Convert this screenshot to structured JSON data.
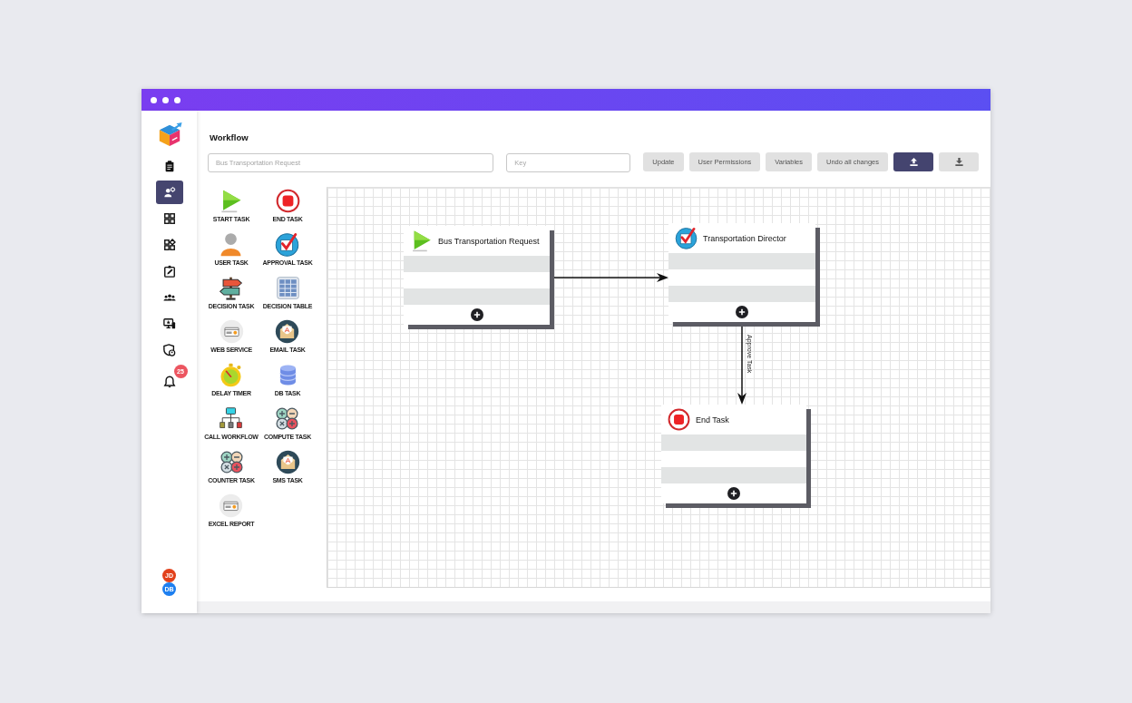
{
  "sidebar": {
    "items": [
      {
        "kind": "clipboard",
        "selected": false
      },
      {
        "kind": "assign",
        "selected": true
      },
      {
        "kind": "apps",
        "selected": false
      },
      {
        "kind": "widgets",
        "selected": false
      },
      {
        "kind": "edit",
        "selected": false
      },
      {
        "kind": "team",
        "selected": false
      },
      {
        "kind": "monitor",
        "selected": false
      },
      {
        "kind": "security",
        "selected": false
      },
      {
        "kind": "bell",
        "selected": false,
        "badge": "25"
      }
    ],
    "users": [
      {
        "initials": "JD",
        "color": "#e2411b"
      },
      {
        "initials": "DB",
        "color": "#1d7ff0"
      }
    ]
  },
  "header": {
    "title": "Workflow",
    "name_field": {
      "value": "Bus Transportation Request"
    },
    "key_field": {
      "placeholder": "Key"
    },
    "buttons": [
      {
        "kind": "text",
        "label": "Update",
        "primary": false
      },
      {
        "kind": "text",
        "label": "User Permissions",
        "primary": false
      },
      {
        "kind": "text",
        "label": "Variables",
        "primary": false
      },
      {
        "kind": "text",
        "label": "Undo all changes",
        "primary": false
      },
      {
        "kind": "upload",
        "primary": true
      },
      {
        "kind": "download",
        "primary": false
      }
    ]
  },
  "palette": {
    "items": [
      {
        "kind": "start",
        "label": "START TASK"
      },
      {
        "kind": "end",
        "label": "END TASK"
      },
      {
        "kind": "user",
        "label": "USER TASK"
      },
      {
        "kind": "approval",
        "label": "APPROVAL TASK"
      },
      {
        "kind": "decision",
        "label": "DECISION TASK"
      },
      {
        "kind": "table",
        "label": "DECISION TABLE"
      },
      {
        "kind": "webservice",
        "label": "WEB SERVICE"
      },
      {
        "kind": "email",
        "label": "EMAIL TASK"
      },
      {
        "kind": "timer",
        "label": "DELAY TIMER"
      },
      {
        "kind": "database",
        "label": "DB TASK"
      },
      {
        "kind": "subflow",
        "label": "CALL WORKFLOW"
      },
      {
        "kind": "compute",
        "label": "COMPUTE TASK"
      },
      {
        "kind": "counter",
        "label": "COUNTER TASK"
      },
      {
        "kind": "sms",
        "label": "SMS TASK"
      },
      {
        "kind": "report",
        "label": "EXCEL REPORT"
      }
    ]
  },
  "canvas": {
    "nodes": [
      {
        "kind": "start",
        "title": "Bus Transportation Request"
      },
      {
        "kind": "approval",
        "title": "Transportation Director"
      },
      {
        "kind": "end",
        "title": "End Task"
      }
    ],
    "connectors": [
      {
        "kind": "horizontal"
      },
      {
        "kind": "vertical",
        "label": "Approve Task"
      }
    ]
  }
}
